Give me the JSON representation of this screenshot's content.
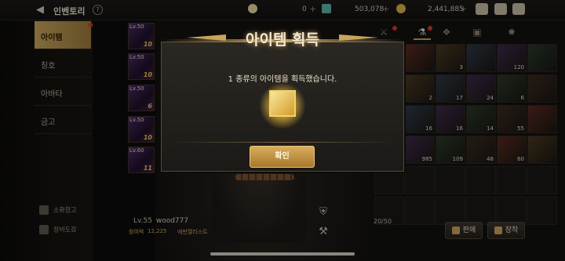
{
  "header": {
    "title": "인벤토리",
    "help_glyph": "?",
    "back_glyph": "◀",
    "currencies": [
      {
        "icon": "crescent-icon",
        "value": "0"
      },
      {
        "icon": "crystal-icon",
        "value": "503,078"
      },
      {
        "icon": "gold-coin-icon",
        "value": "2,441,885"
      }
    ],
    "plus_glyph": "+"
  },
  "left_menu": {
    "items": [
      {
        "label": "아이템",
        "active": true
      },
      {
        "label": "칭호",
        "active": false
      },
      {
        "label": "아바타",
        "active": false
      },
      {
        "label": "금고",
        "active": false
      }
    ],
    "bottom": [
      {
        "label": "소환창고"
      },
      {
        "label": "장비도감"
      }
    ]
  },
  "equipment": [
    {
      "level": "Lv.50",
      "enhance": "10"
    },
    {
      "level": "Lv.50",
      "enhance": "10"
    },
    {
      "level": "Lv.50",
      "enhance": "6"
    },
    {
      "level": "Lv.50",
      "enhance": "10"
    },
    {
      "level": "Lv.60",
      "enhance": "11"
    }
  ],
  "character": {
    "level": "Lv.55",
    "name": "wood777",
    "cp_label": "참여력",
    "cp_value": "12,225",
    "title": "에반젤리스트"
  },
  "inventory": {
    "count": "20/50",
    "rows": [
      [
        "",
        "",
        "3",
        "",
        "120",
        ""
      ],
      [
        "",
        "2",
        "17",
        "24",
        "6",
        ""
      ],
      [
        "",
        "16",
        "16",
        "14",
        "55",
        ""
      ],
      [
        "",
        "985",
        "109",
        "48",
        "60",
        ""
      ]
    ],
    "sell_label": "판매",
    "equip_label": "장착"
  },
  "modal": {
    "title": "아이템 획득",
    "message": "1 종류의 아이템을 획득했습니다.",
    "confirm_label": "확인"
  },
  "colors": {
    "accent_gold": "#c9a45c",
    "alert_red": "#d23b2a"
  }
}
